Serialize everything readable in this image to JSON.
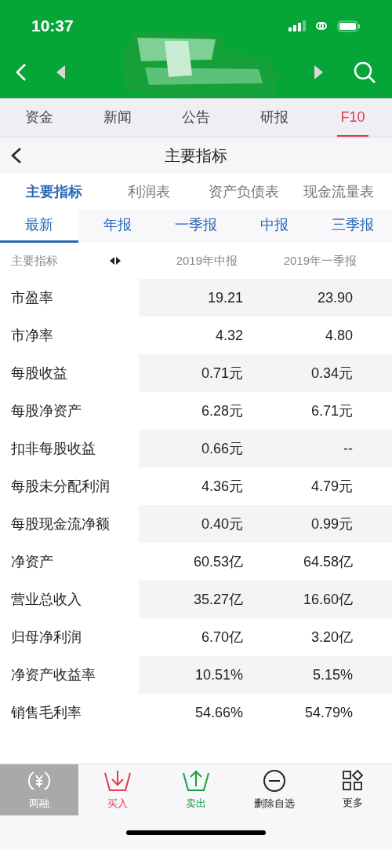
{
  "status_bar": {
    "time": "10:37"
  },
  "top_tabs": [
    {
      "label": "资金",
      "selected": false
    },
    {
      "label": "新闻",
      "selected": false
    },
    {
      "label": "公告",
      "selected": false
    },
    {
      "label": "研报",
      "selected": false
    },
    {
      "label": "F10",
      "selected": true
    }
  ],
  "title": "主要指标",
  "statement_tabs": [
    {
      "label": "主要指标",
      "selected": true
    },
    {
      "label": "利润表",
      "selected": false
    },
    {
      "label": "资产负债表",
      "selected": false
    },
    {
      "label": "现金流量表",
      "selected": false
    }
  ],
  "period_tabs": [
    {
      "label": "最新",
      "selected": true
    },
    {
      "label": "年报",
      "selected": false
    },
    {
      "label": "一季报",
      "selected": false
    },
    {
      "label": "中报",
      "selected": false
    },
    {
      "label": "三季报",
      "selected": false
    }
  ],
  "table": {
    "columns": [
      "主要指标",
      "2019年中报",
      "2019年一季报"
    ],
    "rows": [
      {
        "label": "市盈率",
        "values": [
          "19.21",
          "23.90"
        ]
      },
      {
        "label": "市净率",
        "values": [
          "4.32",
          "4.80"
        ]
      },
      {
        "label": "每股收益",
        "values": [
          "0.71元",
          "0.34元"
        ]
      },
      {
        "label": "每股净资产",
        "values": [
          "6.28元",
          "6.71元"
        ]
      },
      {
        "label": "扣非每股收益",
        "values": [
          "0.66元",
          "--"
        ]
      },
      {
        "label": "每股未分配利润",
        "values": [
          "4.36元",
          "4.79元"
        ]
      },
      {
        "label": "每股现金流净额",
        "values": [
          "0.40元",
          "0.99元"
        ]
      },
      {
        "label": "净资产",
        "values": [
          "60.53亿",
          "64.58亿"
        ]
      },
      {
        "label": "营业总收入",
        "values": [
          "35.27亿",
          "16.60亿"
        ]
      },
      {
        "label": "归母净利润",
        "values": [
          "6.70亿",
          "3.20亿"
        ]
      },
      {
        "label": "净资产收益率",
        "values": [
          "10.51%",
          "5.15%"
        ]
      },
      {
        "label": "销售毛利率",
        "values": [
          "54.66%",
          "54.79%"
        ]
      }
    ]
  },
  "bottom_bar": [
    {
      "kind": "margin",
      "label": "两融",
      "selected": true
    },
    {
      "kind": "buy",
      "label": "买入",
      "selected": false
    },
    {
      "kind": "sell",
      "label": "卖出",
      "selected": false
    },
    {
      "kind": "remove",
      "label": "删除自选",
      "selected": false
    },
    {
      "kind": "more",
      "label": "更多",
      "selected": false
    }
  ]
}
